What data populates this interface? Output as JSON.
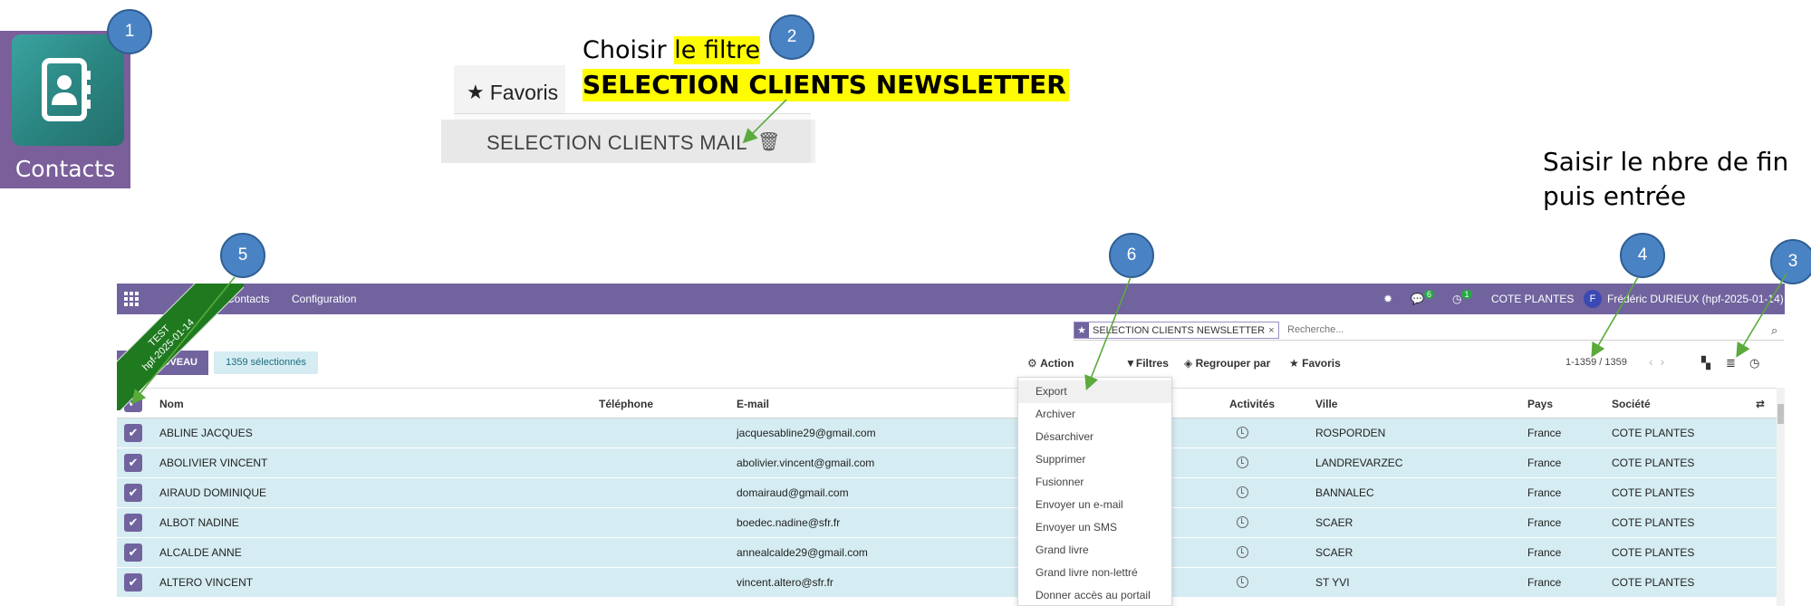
{
  "app_tile": {
    "label": "Contacts",
    "icon": "contacts-book-icon"
  },
  "markers": [
    "1",
    "2",
    "3",
    "4",
    "5",
    "6"
  ],
  "favoris_crop": {
    "header_label": "Favoris",
    "item_label": "SELECTION CLIENTS MAIL",
    "item_icon": "trash-icon"
  },
  "annotations": {
    "filter_prefix": "Choisir ",
    "filter_highlight": "le filtre",
    "filter_name": "SELECTION CLIENTS NEWSLETTER",
    "pager_line1": "Saisir le nbre de fin",
    "pager_line2": "puis entrée"
  },
  "navbar": {
    "menu": [
      "Contacts",
      "Configuration"
    ],
    "messages_badge": "6",
    "activities_badge": "1",
    "company": "COTE PLANTES",
    "user_initial": "F",
    "user_label": "Frédéric DURIEUX (hpf-2025-01-14)"
  },
  "ribbon": {
    "line1": "TEST",
    "line2": "hpf-2025-01-14"
  },
  "search": {
    "facet_label": "SELECTION CLIENTS NEWSLETTER",
    "placeholder": "Recherche..."
  },
  "controls": {
    "new_button": "NOUVEAU",
    "selected_count": "1359 sélectionnés",
    "action": "Action",
    "filters": "Filtres",
    "group_by": "Regrouper par",
    "favorites": "Favoris",
    "pager": "1-1359 / 1359"
  },
  "table": {
    "columns": [
      "Nom",
      "Téléphone",
      "E-mail",
      "Activités",
      "Ville",
      "Pays",
      "Société"
    ],
    "rows": [
      {
        "nom": "ABLINE JACQUES",
        "email": "jacquesabline29@gmail.com",
        "ville": "ROSPORDEN",
        "pays": "France",
        "societe": "COTE PLANTES"
      },
      {
        "nom": "ABOLIVIER VINCENT",
        "email": "abolivier.vincent@gmail.com",
        "ville": "LANDREVARZEC",
        "pays": "France",
        "societe": "COTE PLANTES"
      },
      {
        "nom": "AIRAUD DOMINIQUE",
        "email": "domairaud@gmail.com",
        "ville": "BANNALEC",
        "pays": "France",
        "societe": "COTE PLANTES"
      },
      {
        "nom": "ALBOT NADINE",
        "email": "boedec.nadine@sfr.fr",
        "ville": "SCAER",
        "pays": "France",
        "societe": "COTE PLANTES"
      },
      {
        "nom": "ALCALDE ANNE",
        "email": "annealcalde29@gmail.com",
        "ville": "SCAER",
        "pays": "France",
        "societe": "COTE PLANTES"
      },
      {
        "nom": "ALTERO VINCENT",
        "email": "vincent.altero@sfr.fr",
        "ville": "ST YVI",
        "pays": "France",
        "societe": "COTE PLANTES"
      }
    ]
  },
  "action_menu": {
    "items": [
      "Export",
      "Archiver",
      "Désarchiver",
      "Supprimer",
      "Fusionner",
      "Envoyer un e-mail",
      "Envoyer un SMS",
      "Grand livre",
      "Grand livre non-lettré",
      "Donner accès au portail"
    ]
  },
  "colors": {
    "brand_purple": "#71639e",
    "selected_row": "#d5ecf2",
    "marker_blue": "#4a83c4",
    "arrow_green": "#5aaa3c",
    "highlight_yellow": "#fffb00",
    "ribbon_green": "#1f7a1f"
  }
}
